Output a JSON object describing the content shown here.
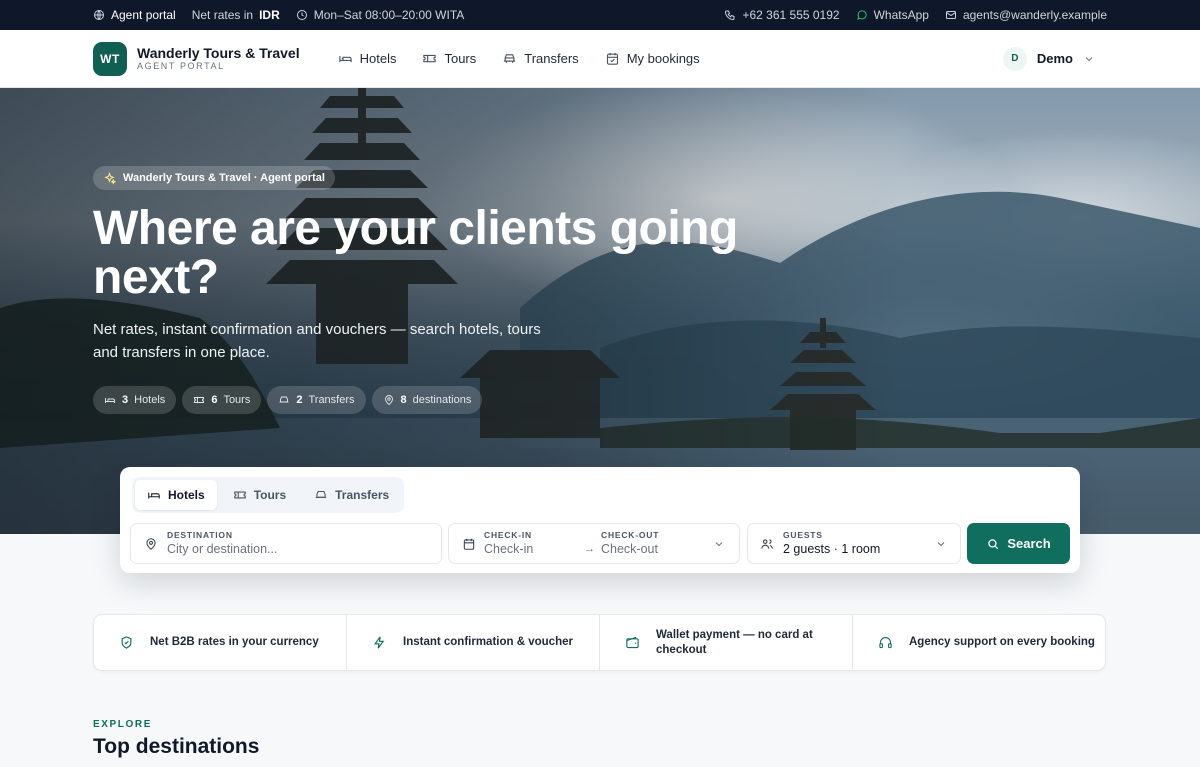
{
  "topbar": {
    "portal": "Agent portal",
    "net_rates_prefix": "Net rates in",
    "currency": "IDR",
    "hours": "Mon–Sat 08:00–20:00 WITA",
    "phone": "+62 361 555 0192",
    "whatsapp": "WhatsApp",
    "email": "agents@wanderly.example"
  },
  "header": {
    "logo_text": "WT",
    "brand_name": "Wanderly Tours & Travel",
    "brand_sub": "AGENT PORTAL",
    "nav": [
      {
        "label": "Hotels",
        "icon": "bed-icon"
      },
      {
        "label": "Tours",
        "icon": "ticket-icon"
      },
      {
        "label": "Transfers",
        "icon": "car-icon"
      },
      {
        "label": "My bookings",
        "icon": "calendar-check-icon"
      }
    ],
    "user": {
      "initial": "D",
      "name": "Demo"
    }
  },
  "hero": {
    "pill": "Wanderly Tours & Travel · Agent portal",
    "title": "Where are your clients going next?",
    "lead": "Net rates, instant confirmation and vouchers — search hotels, tours and transfers in one place.",
    "stats": [
      {
        "count": "3",
        "label": "Hotels",
        "icon": "bed-icon"
      },
      {
        "count": "6",
        "label": "Tours",
        "icon": "ticket-icon"
      },
      {
        "count": "2",
        "label": "Transfers",
        "icon": "car-icon"
      },
      {
        "count": "8",
        "label": "destinations",
        "icon": "map-pin-icon"
      }
    ]
  },
  "search": {
    "tabs": [
      {
        "label": "Hotels",
        "active": true
      },
      {
        "label": "Tours",
        "active": false
      },
      {
        "label": "Transfers",
        "active": false
      }
    ],
    "destination": {
      "label": "DESTINATION",
      "placeholder": "City or destination..."
    },
    "checkin": {
      "label": "CHECK-IN",
      "placeholder": "Check-in"
    },
    "checkout": {
      "label": "CHECK-OUT",
      "placeholder": "Check-out"
    },
    "guests": {
      "label": "GUESTS",
      "value": "2 guests · 1 room"
    },
    "button": "Search"
  },
  "features": [
    {
      "label": "Net B2B rates in your currency",
      "icon": "shield-check-icon"
    },
    {
      "label": "Instant confirmation & voucher",
      "icon": "lightning-icon"
    },
    {
      "label": "Wallet payment — no card at checkout",
      "icon": "wallet-icon"
    },
    {
      "label": "Agency support on every booking",
      "icon": "headset-icon"
    }
  ],
  "section": {
    "eyebrow": "EXPLORE",
    "title": "Top destinations"
  },
  "colors": {
    "accent": "#0f6e5e",
    "topbar": "#0f172a"
  }
}
